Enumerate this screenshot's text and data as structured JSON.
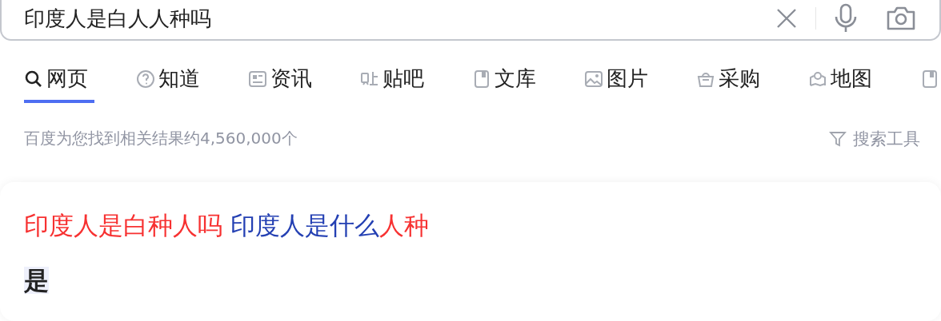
{
  "search": {
    "value": "印度人是白人人种吗"
  },
  "tabs": [
    {
      "label": "网页",
      "kind": "search",
      "selected": true
    },
    {
      "label": "知道",
      "kind": "question",
      "selected": false
    },
    {
      "label": "资讯",
      "kind": "news",
      "selected": false
    },
    {
      "label": "贴吧",
      "kind": "tieba",
      "selected": false
    },
    {
      "label": "文库",
      "kind": "doc",
      "selected": false
    },
    {
      "label": "图片",
      "kind": "image",
      "selected": false
    },
    {
      "label": "采购",
      "kind": "basket",
      "selected": false
    },
    {
      "label": "地图",
      "kind": "map",
      "selected": false
    },
    {
      "kind": "doc",
      "selected": false
    }
  ],
  "result_count": "百度为您找到相关结果约4,560,000个",
  "search_tools": "搜索工具",
  "result": {
    "title": [
      {
        "text": "印度人是白种人吗",
        "highlight": true
      },
      {
        "text": " 印度人是什么",
        "highlight": false
      },
      {
        "text": "人种",
        "highlight": true
      }
    ],
    "answer": "是"
  }
}
